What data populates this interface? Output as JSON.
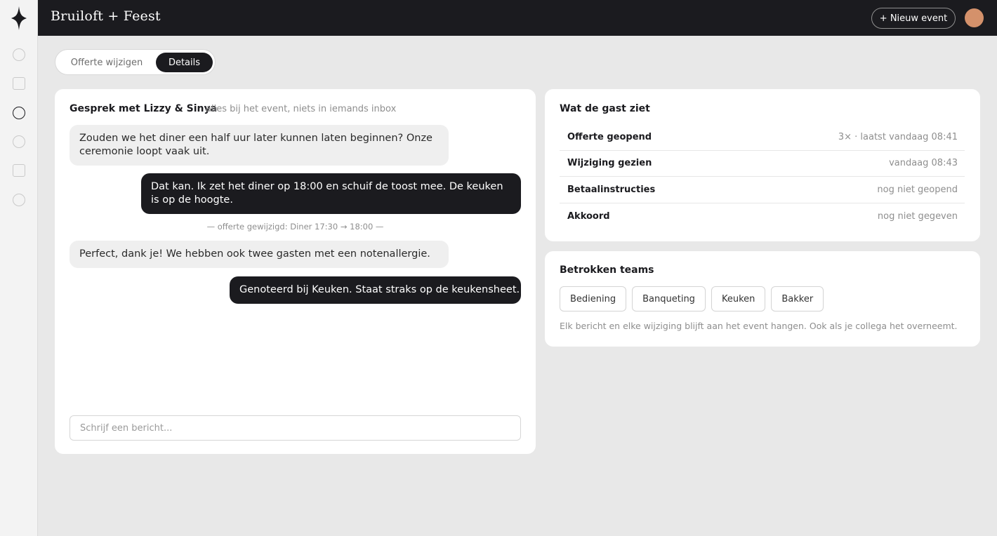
{
  "app": {
    "brand": "Bruiloft + Feest",
    "new_event_label": "+ Nieuw event",
    "accent": "#1b1b1f",
    "avatar_color": "#d4916b"
  },
  "sidebar": {
    "logo_icon": "four-point-star-icon",
    "items": [
      {
        "icon": "circle-icon",
        "active": false
      },
      {
        "icon": "square-icon",
        "active": false
      },
      {
        "icon": "circle-icon",
        "active": true
      },
      {
        "icon": "circle-icon",
        "active": false
      },
      {
        "icon": "square-icon",
        "active": false
      },
      {
        "icon": "circle-icon",
        "active": false
      }
    ]
  },
  "tabs": [
    {
      "label": "Offerte wijzigen",
      "active": false
    },
    {
      "label": "Details",
      "active": true
    }
  ],
  "chat": {
    "title": "Gesprek met Lizzy & Sinya",
    "subtitle": "alles bij het event, niets in iemands inbox",
    "messages": [
      {
        "direction": "in",
        "text": "Zouden we het diner een half uur later kunnen laten beginnen? Onze ceremonie loopt vaak uit."
      },
      {
        "direction": "out",
        "text": "Dat kan. Ik zet het diner op 18:00 en schuif de toost mee. De keuken is op de hoogte."
      },
      {
        "direction": "event",
        "text": "— offerte gewijzigd: Diner 17:30 → 18:00 —"
      },
      {
        "direction": "in",
        "text": "Perfect, dank je! We hebben ook twee gasten met een notenallergie."
      },
      {
        "direction": "out",
        "text": "Genoteerd bij Keuken. Staat straks op de keukensheet."
      }
    ],
    "input_placeholder": "Schrijf een bericht..."
  },
  "guest_view": {
    "title": "Wat de gast ziet",
    "rows": [
      {
        "label": "Offerte geopend",
        "value": "3× · laatst vandaag 08:41"
      },
      {
        "label": "Wijziging gezien",
        "value": "vandaag 08:43"
      },
      {
        "label": "Betaalinstructies",
        "value": "nog niet geopend"
      },
      {
        "label": "Akkoord",
        "value": "nog niet gegeven"
      }
    ]
  },
  "teams": {
    "title": "Betrokken teams",
    "chips": [
      "Bediening",
      "Banqueting",
      "Keuken",
      "Bakker"
    ],
    "note": "Elk bericht en elke wijziging blijft aan het event hangen. Ook als je collega het overneemt."
  }
}
